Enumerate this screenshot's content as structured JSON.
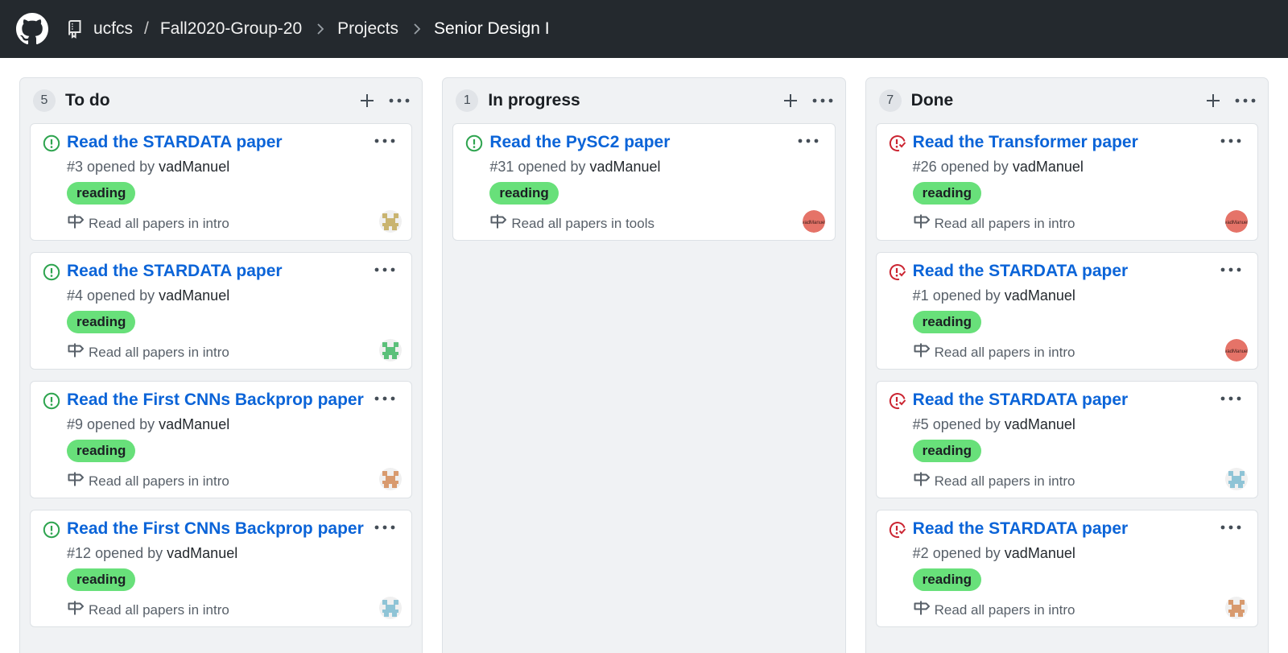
{
  "header": {
    "org": "ucfcs",
    "repo": "Fall2020-Group-20",
    "projects_label": "Projects",
    "project_name": "Senior Design I"
  },
  "colors": {
    "open_issue": "#2ea44f",
    "closed_issue": "#cb2431",
    "link": "#0b64d8",
    "label_reading": "#68e07a"
  },
  "columns": [
    {
      "count": "5",
      "name": "To do",
      "cards": [
        {
          "title": "Read the STARDATA paper",
          "number": "#3",
          "opened_by": "opened by",
          "user": "vadManuel",
          "label": "reading",
          "milestone": "Read all papers in intro",
          "status": "open",
          "avatar": "identicon-gold"
        },
        {
          "title": "Read the STARDATA paper",
          "number": "#4",
          "opened_by": "opened by",
          "user": "vadManuel",
          "label": "reading",
          "milestone": "Read all papers in intro",
          "status": "open",
          "avatar": "identicon-green"
        },
        {
          "title": "Read the First CNNs Backprop paper",
          "number": "#9",
          "opened_by": "opened by",
          "user": "vadManuel",
          "label": "reading",
          "milestone": "Read all papers in intro",
          "status": "open",
          "avatar": "identicon-orange"
        },
        {
          "title": "Read the First CNNs Backprop paper",
          "number": "#12",
          "opened_by": "opened by",
          "user": "vadManuel",
          "label": "reading",
          "milestone": "Read all papers in intro",
          "status": "open",
          "avatar": "identicon-blue"
        }
      ]
    },
    {
      "count": "1",
      "name": "In progress",
      "cards": [
        {
          "title": "Read the PySC2 paper",
          "number": "#31",
          "opened_by": "opened by",
          "user": "vadManuel",
          "label": "reading",
          "milestone": "Read all papers in tools",
          "status": "open",
          "avatar": "photo-red"
        }
      ]
    },
    {
      "count": "7",
      "name": "Done",
      "cards": [
        {
          "title": "Read the Transformer paper",
          "number": "#26",
          "opened_by": "opened by",
          "user": "vadManuel",
          "label": "reading",
          "milestone": "Read all papers in intro",
          "status": "closed",
          "avatar": "photo-red"
        },
        {
          "title": "Read the STARDATA paper",
          "number": "#1",
          "opened_by": "opened by",
          "user": "vadManuel",
          "label": "reading",
          "milestone": "Read all papers in intro",
          "status": "closed",
          "avatar": "photo-red"
        },
        {
          "title": "Read the STARDATA paper",
          "number": "#5",
          "opened_by": "opened by",
          "user": "vadManuel",
          "label": "reading",
          "milestone": "Read all papers in intro",
          "status": "closed",
          "avatar": "identicon-blue"
        },
        {
          "title": "Read the STARDATA paper",
          "number": "#2",
          "opened_by": "opened by",
          "user": "vadManuel",
          "label": "reading",
          "milestone": "Read all papers in intro",
          "status": "closed",
          "avatar": "identicon-orange"
        }
      ]
    }
  ]
}
